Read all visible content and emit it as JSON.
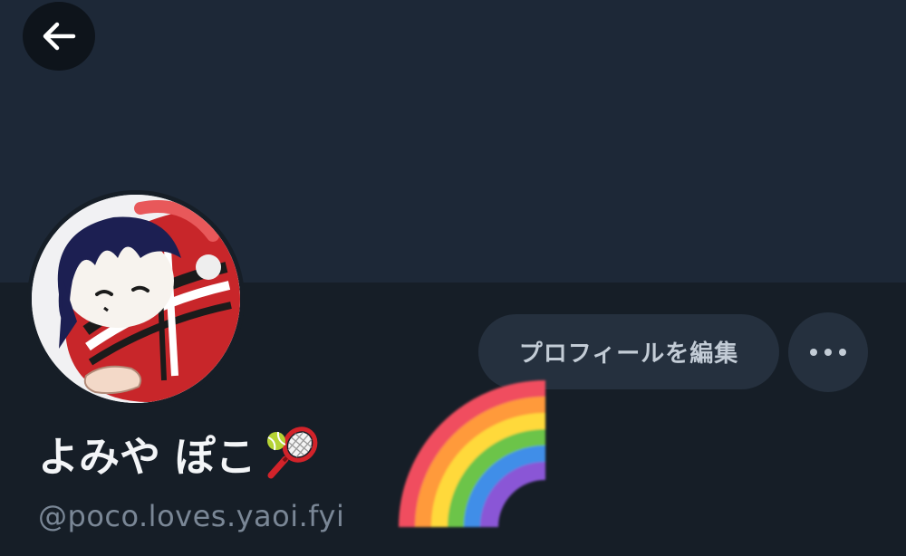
{
  "header": {
    "back_icon": "arrow-left-icon"
  },
  "profile": {
    "avatar_icon": "avatar-plush-image",
    "display_name": "よみや ぽこ",
    "name_emoji": "tennis-racket-icon",
    "handle": "@poco.loves.yaoi.fyi",
    "decoration": "rainbow-icon"
  },
  "actions": {
    "edit_profile_label": "プロフィールを編集",
    "more_icon": "more-horizontal-icon"
  },
  "colors": {
    "banner": "#1d2837",
    "background": "#161e27",
    "button_bg": "#25303e",
    "button_text": "#c3ccd6",
    "name_text": "#f3f5f7",
    "handle_text": "#7a8796"
  }
}
